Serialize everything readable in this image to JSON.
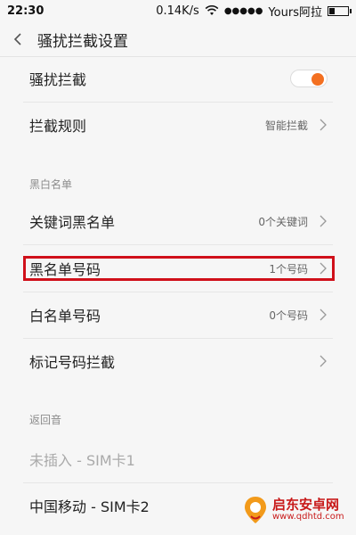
{
  "status_bar": {
    "time": "22:30",
    "speed": "0.14K/s",
    "signal": "●●●●●",
    "carrier": "Yours阿拉"
  },
  "header": {
    "title": "骚扰拦截设置"
  },
  "rows": {
    "intercept": {
      "label": "骚扰拦截",
      "toggle_on": true
    },
    "rules": {
      "label": "拦截规则",
      "value": "智能拦截"
    },
    "keyword_blacklist": {
      "label": "关键词黑名单",
      "value": "0个关键词"
    },
    "blacklist_numbers": {
      "label": "黑名单号码",
      "value": "1个号码"
    },
    "whitelist_numbers": {
      "label": "白名单号码",
      "value": "0个号码"
    },
    "marked_numbers": {
      "label": "标记号码拦截"
    },
    "sim1": {
      "label": "未插入 - SIM卡1"
    },
    "sim2": {
      "label": "中国移动 - SIM卡2"
    }
  },
  "sections": {
    "black_white": "黑白名单",
    "busy_tone": "返回音"
  },
  "watermark": {
    "title": "启东安卓网",
    "url": "www.qdhtd.com"
  },
  "colors": {
    "accent": "#f37021",
    "highlight": "#d0101a"
  }
}
